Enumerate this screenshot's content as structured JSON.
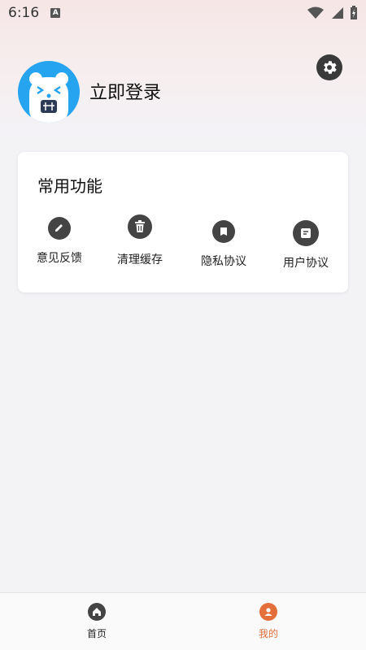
{
  "status_bar": {
    "time": "6:16",
    "notification_letter": "A"
  },
  "header": {
    "login_title": "立即登录"
  },
  "card": {
    "title": "常用功能",
    "items": [
      {
        "label": "意见反馈",
        "icon": "pencil-icon"
      },
      {
        "label": "清理缓存",
        "icon": "trash-icon"
      },
      {
        "label": "隐私协议",
        "icon": "document-icon"
      },
      {
        "label": "用户协议",
        "icon": "note-icon"
      }
    ]
  },
  "bottom_nav": {
    "items": [
      {
        "label": "首页",
        "icon": "home-icon"
      },
      {
        "label": "我的",
        "icon": "user-icon",
        "active": true
      }
    ]
  },
  "colors": {
    "accent": "#e56f3a",
    "icon_dark": "#444444",
    "avatar_blue": "#27a4ef"
  }
}
